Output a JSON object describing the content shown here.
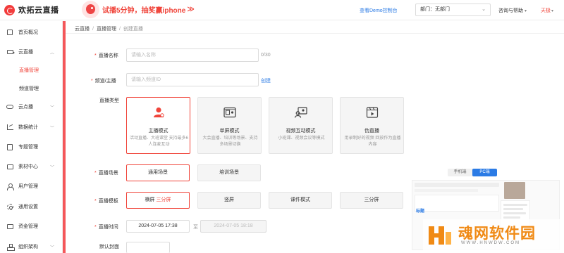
{
  "header": {
    "brand": "欢拓云直播",
    "promo_text": "试播5分钟，抽奖赢iphone",
    "promo_arrow": "≫",
    "demo_link": "查看Demo控制台",
    "department": "部门：无部门",
    "help": "咨询与帮助",
    "user": "天极"
  },
  "sidebar": {
    "items": [
      {
        "label": "首页概况",
        "icon": "home-icon"
      },
      {
        "label": "云直播",
        "icon": "live-camera-icon",
        "expanded": true
      },
      {
        "label": "云点播",
        "icon": "cloud-icon"
      },
      {
        "label": "数据统计",
        "icon": "chart-icon"
      },
      {
        "label": "专题管理",
        "icon": "book-icon"
      },
      {
        "label": "素材中心",
        "icon": "folder-icon"
      },
      {
        "label": "用户管理",
        "icon": "user-icon"
      },
      {
        "label": "通用设置",
        "icon": "gear-icon"
      },
      {
        "label": "资金管理",
        "icon": "money-icon"
      },
      {
        "label": "组织架构",
        "icon": "org-icon"
      }
    ],
    "sub_items": [
      {
        "label": "直播管理",
        "active": true
      },
      {
        "label": "频道管理",
        "active": false
      }
    ]
  },
  "breadcrumb": [
    "云直播",
    "直播管理",
    "创建直播"
  ],
  "form": {
    "name_label": "直播名称",
    "name_placeholder": "请输入名称",
    "name_counter": "0/30",
    "channel_label": "频道/主播",
    "channel_placeholder": "请输入频道ID",
    "channel_create": "创建",
    "type_label": "直播类型",
    "types": [
      {
        "title": "主播模式",
        "desc": "活动直播、大班课堂 支持最多6人连麦互动",
        "icon": "anchor-icon",
        "selected": true
      },
      {
        "title": "单屏模式",
        "desc": "大会直播、培训等场景、支持多场景切换",
        "icon": "single-screen-icon",
        "selected": false
      },
      {
        "title": "视频互动模式",
        "desc": "小班课、视频会议等模式",
        "icon": "video-interactive-icon",
        "selected": false
      },
      {
        "title": "伪直播",
        "desc": "用录制好的视频 回放作为直播内容",
        "icon": "pseudo-live-icon",
        "selected": false
      }
    ],
    "scene_label": "直播场景",
    "scenes": [
      {
        "label": "通用场景",
        "selected": true
      },
      {
        "label": "培训场景",
        "selected": false
      }
    ],
    "template_label": "直播模板",
    "templates": [
      {
        "label": "横屏",
        "highlight": "三分屏",
        "selected": true
      },
      {
        "label": "竖屏",
        "highlight": "",
        "selected": false
      },
      {
        "label": "课件模式",
        "highlight": "",
        "selected": false
      },
      {
        "label": "三分屏",
        "highlight": "",
        "selected": false
      }
    ],
    "time_label": "直播时间",
    "start_time": "2024-07-05 17:38",
    "to": "至",
    "end_time": "2024-07-05 18:18",
    "cover_label": "默认封面"
  },
  "preview": {
    "tab_mobile": "手机端",
    "tab_pc": "PC端",
    "tag": "标题"
  },
  "watermark": {
    "text": "魂网软件园",
    "url": "WWW.HNWDW.COM"
  },
  "colors": {
    "accent": "#f0443a",
    "link": "#2b7be5",
    "watermark": "#f08a15"
  }
}
